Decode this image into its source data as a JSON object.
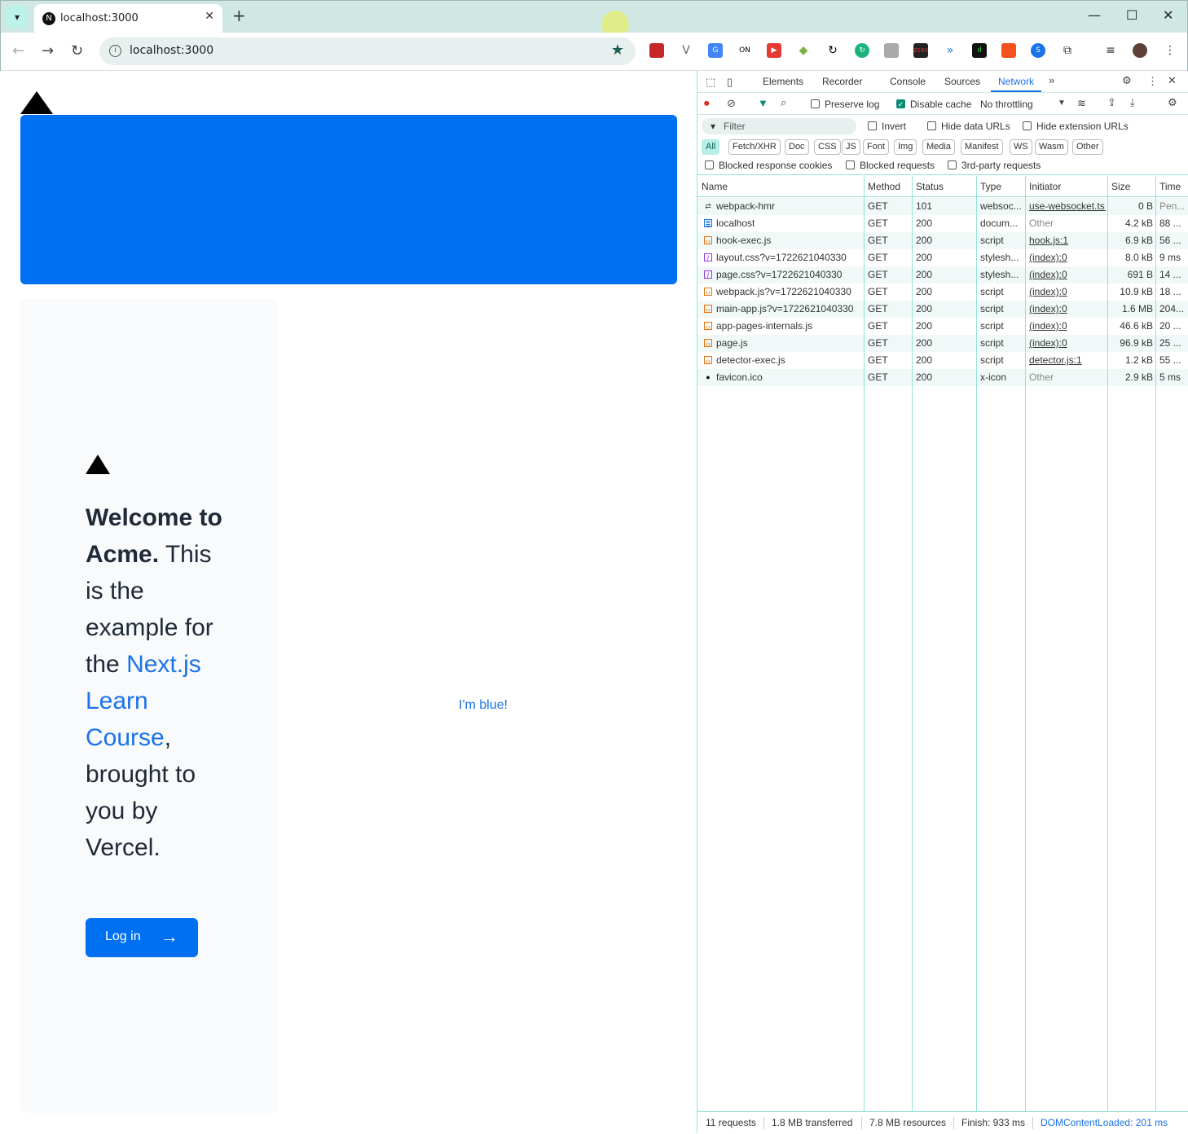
{
  "browser": {
    "tab_title": "localhost:3000",
    "favicon_letter": "N",
    "url": "localhost:3000",
    "new_tab": "+",
    "close_tab": "✕"
  },
  "page": {
    "welcome_bold": "Welcome to Acme.",
    "welcome_text1": "This is the example for the",
    "welcome_link": "Next.js Learn Course",
    "welcome_text2": ", brought to you by Vercel.",
    "login_label": "Log in",
    "blue_text": "I'm blue!"
  },
  "devtools": {
    "tabs": [
      "Elements",
      "Recorder",
      "Console",
      "Sources",
      "Network"
    ],
    "active_tab": "Network",
    "preserve_log": "Preserve log",
    "disable_cache": "Disable cache",
    "throttling": "No throttling",
    "filter_placeholder": "Filter",
    "invert": "Invert",
    "hide_data_urls": "Hide data URLs",
    "hide_extension_urls": "Hide extension URLs",
    "type_filters": [
      "All",
      "Fetch/XHR",
      "Doc",
      "CSS",
      "JS",
      "Font",
      "Img",
      "Media",
      "Manifest",
      "WS",
      "Wasm",
      "Other"
    ],
    "blocked_response_cookies": "Blocked response cookies",
    "blocked_requests": "Blocked requests",
    "third_party_requests": "3rd-party requests",
    "columns": [
      "Name",
      "Method",
      "Status",
      "Type",
      "Initiator",
      "Size",
      "Time"
    ],
    "requests": [
      {
        "name": "webpack-hmr",
        "method": "GET",
        "status": "101",
        "type": "websoc...",
        "initiator": "use-websocket.ts:",
        "size": "0 B",
        "time": "Pen...",
        "icon": "ws"
      },
      {
        "name": "localhost",
        "method": "GET",
        "status": "200",
        "type": "docum...",
        "initiator": "Other",
        "size": "4.2 kB",
        "time": "88 ...",
        "icon": "doc"
      },
      {
        "name": "hook-exec.js",
        "method": "GET",
        "status": "200",
        "type": "script",
        "initiator": "hook.js:1",
        "size": "6.9 kB",
        "time": "56 ...",
        "icon": "js"
      },
      {
        "name": "layout.css?v=1722621040330",
        "method": "GET",
        "status": "200",
        "type": "stylesh...",
        "initiator": "(index):0",
        "size": "8.0 kB",
        "time": "9 ms",
        "icon": "css"
      },
      {
        "name": "page.css?v=1722621040330",
        "method": "GET",
        "status": "200",
        "type": "stylesh...",
        "initiator": "(index):0",
        "size": "691 B",
        "time": "14 ...",
        "icon": "css"
      },
      {
        "name": "webpack.js?v=1722621040330",
        "method": "GET",
        "status": "200",
        "type": "script",
        "initiator": "(index):0",
        "size": "10.9 kB",
        "time": "18 ...",
        "icon": "js"
      },
      {
        "name": "main-app.js?v=1722621040330",
        "method": "GET",
        "status": "200",
        "type": "script",
        "initiator": "(index):0",
        "size": "1.6 MB",
        "time": "204...",
        "icon": "js"
      },
      {
        "name": "app-pages-internals.js",
        "method": "GET",
        "status": "200",
        "type": "script",
        "initiator": "(index):0",
        "size": "46.6 kB",
        "time": "20 ...",
        "icon": "js"
      },
      {
        "name": "page.js",
        "method": "GET",
        "status": "200",
        "type": "script",
        "initiator": "(index):0",
        "size": "96.9 kB",
        "time": "25 ...",
        "icon": "js"
      },
      {
        "name": "detector-exec.js",
        "method": "GET",
        "status": "200",
        "type": "script",
        "initiator": "detector.js:1",
        "size": "1.2 kB",
        "time": "55 ...",
        "icon": "js"
      },
      {
        "name": "favicon.ico",
        "method": "GET",
        "status": "200",
        "type": "x-icon",
        "initiator": "Other",
        "size": "2.9 kB",
        "time": "5 ms",
        "icon": "img"
      }
    ],
    "status": {
      "requests": "11 requests",
      "transferred": "1.8 MB transferred",
      "resources": "7.8 MB resources",
      "finish": "Finish: 933 ms",
      "dcl": "DOMContentLoaded: 201 ms"
    }
  }
}
